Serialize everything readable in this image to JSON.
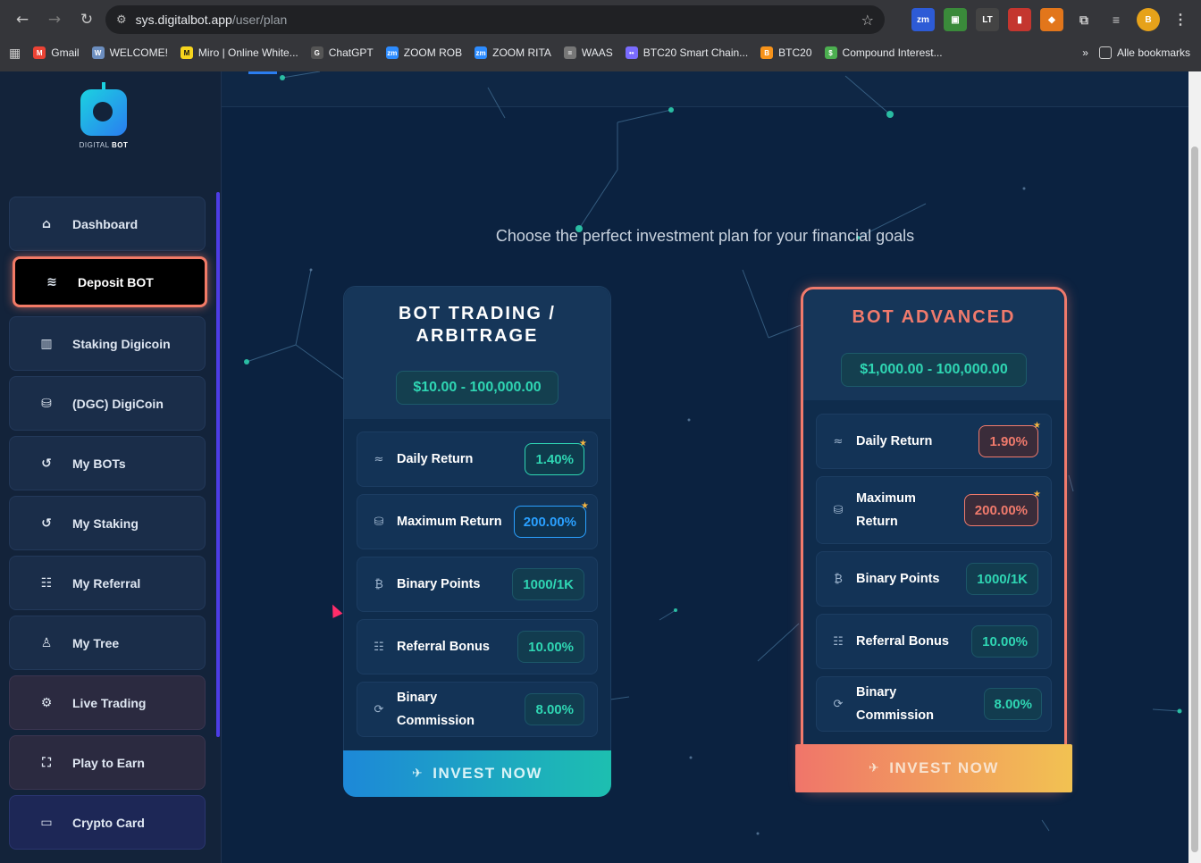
{
  "browser": {
    "url_host": "sys.digitalbot.app",
    "url_path": "/user/plan",
    "bookmarks": [
      {
        "label": "Gmail",
        "color": "#ea4335"
      },
      {
        "label": "WELCOME!",
        "color": "#6c8ebf"
      },
      {
        "label": "Miro | Online White...",
        "color": "#f7d51d"
      },
      {
        "label": "ChatGPT",
        "color": "#555555"
      },
      {
        "label": "ZOOM ROB",
        "color": "#2d8cff"
      },
      {
        "label": "ZOOM RITA",
        "color": "#2d8cff"
      },
      {
        "label": "WAAS",
        "color": "#777777"
      },
      {
        "label": "BTC20 Smart Chain...",
        "color": "#7a6cff"
      },
      {
        "label": "BTC20",
        "color": "#f7931a"
      },
      {
        "label": "Compound Interest...",
        "color": "#4caf50"
      }
    ],
    "overflow_label": "»",
    "all_bookmarks": "Alle bookmarks"
  },
  "logo": {
    "text_1": "DIGITAL",
    "text_2": "BOT"
  },
  "sidebar": {
    "items": [
      {
        "label": "Dashboard",
        "icon": "home-icon"
      },
      {
        "label": "Deposit BOT",
        "icon": "layers-icon"
      },
      {
        "label": "Staking Digicoin",
        "icon": "bar-chart-icon"
      },
      {
        "label": "(DGC) DigiCoin",
        "icon": "coins-icon"
      },
      {
        "label": "My BOTs",
        "icon": "history-icon"
      },
      {
        "label": "My Staking",
        "icon": "history-icon"
      },
      {
        "label": "My Referral",
        "icon": "users-icon"
      },
      {
        "label": "My Tree",
        "icon": "tree-icon"
      },
      {
        "label": "Live Trading",
        "icon": "robot-icon"
      },
      {
        "label": "Play to Earn",
        "icon": "ticket-icon"
      },
      {
        "label": "Crypto Card",
        "icon": "card-icon"
      }
    ]
  },
  "main": {
    "subtitle": "Choose the perfect investment plan for your financial goals",
    "plans": [
      {
        "title_line1": "BOT TRADING /",
        "title_line2": "ARBITRAGE",
        "price": "$10.00 - 100,000.00",
        "rows": [
          {
            "label": "Daily Return",
            "value": "1.40%"
          },
          {
            "label": "Maximum Return",
            "value": "200.00%"
          },
          {
            "label": "Binary Points",
            "value": "1000/1K"
          },
          {
            "label": "Referral Bonus",
            "value": "10.00%"
          },
          {
            "label": "Binary Commission",
            "value": "8.00%"
          }
        ],
        "cta": "INVEST NOW"
      },
      {
        "title_line1": "BOT ADVANCED",
        "price": "$1,000.00 - 100,000.00",
        "rows": [
          {
            "label": "Daily Return",
            "value": "1.90%"
          },
          {
            "label_line1": "Maximum",
            "label_line2": "Return",
            "value": "200.00%"
          },
          {
            "label": "Binary Points",
            "value": "1000/1K"
          },
          {
            "label": "Referral Bonus",
            "value": "10.00%"
          },
          {
            "label": "Binary Commission",
            "value": "8.00%"
          }
        ],
        "cta": "INVEST NOW"
      }
    ]
  },
  "colors": {
    "accent_teal": "#2fd6b3",
    "accent_coral": "#f07a6c",
    "accent_blue": "#2aa0ff",
    "bg": "#0b2240"
  }
}
